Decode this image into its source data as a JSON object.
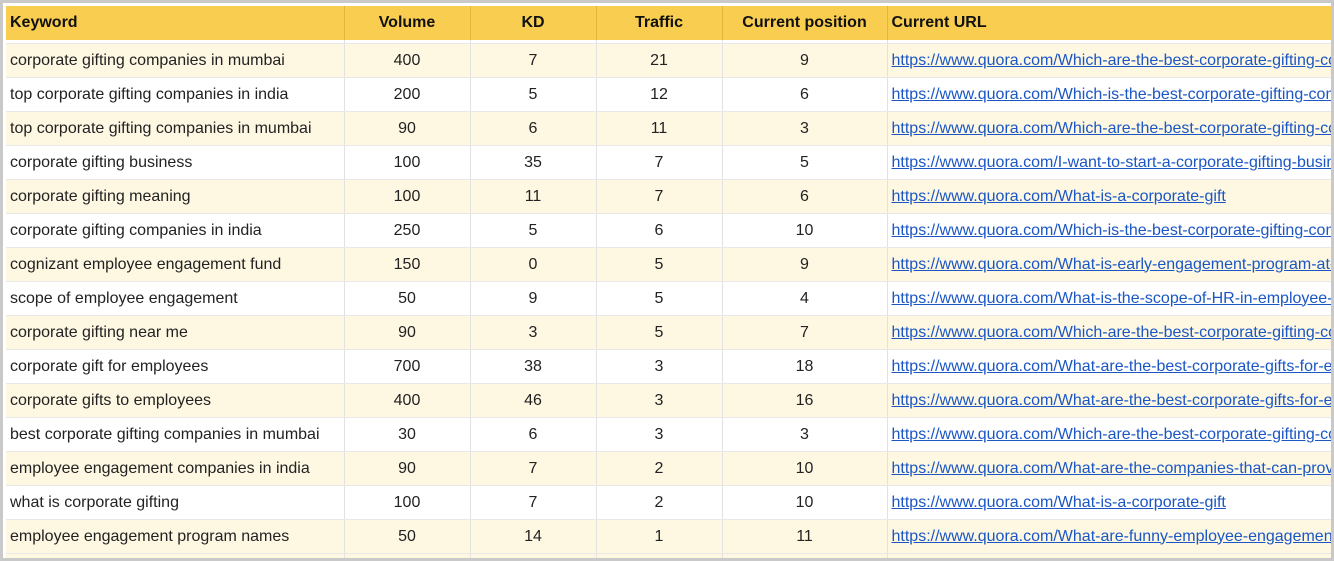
{
  "headers": {
    "keyword": "Keyword",
    "volume": "Volume",
    "kd": "KD",
    "traffic": "Traffic",
    "position": "Current position",
    "url": "Current URL"
  },
  "rows": [
    {
      "keyword": "corporate gifting companies in mumbai",
      "volume": "400",
      "kd": "7",
      "traffic": "21",
      "position": "9",
      "url": "https://www.quora.com/Which-are-the-best-corporate-gifting-companies-in-Mumbai"
    },
    {
      "keyword": "top corporate gifting companies in india",
      "volume": "200",
      "kd": "5",
      "traffic": "12",
      "position": "6",
      "url": "https://www.quora.com/Which-is-the-best-corporate-gifting-company-in-India"
    },
    {
      "keyword": "top corporate gifting companies in mumbai",
      "volume": "90",
      "kd": "6",
      "traffic": "11",
      "position": "3",
      "url": "https://www.quora.com/Which-are-the-best-corporate-gifting-companies-in-Mumbai"
    },
    {
      "keyword": "corporate gifting business",
      "volume": "100",
      "kd": "35",
      "traffic": "7",
      "position": "5",
      "url": "https://www.quora.com/I-want-to-start-a-corporate-gifting-business"
    },
    {
      "keyword": "corporate gifting meaning",
      "volume": "100",
      "kd": "11",
      "traffic": "7",
      "position": "6",
      "url": "https://www.quora.com/What-is-a-corporate-gift"
    },
    {
      "keyword": "corporate gifting companies in india",
      "volume": "250",
      "kd": "5",
      "traffic": "6",
      "position": "10",
      "url": "https://www.quora.com/Which-is-the-best-corporate-gifting-company-in-India"
    },
    {
      "keyword": "cognizant employee engagement fund",
      "volume": "150",
      "kd": "0",
      "traffic": "5",
      "position": "9",
      "url": "https://www.quora.com/What-is-early-engagement-program-at-Cognizant"
    },
    {
      "keyword": "scope of employee engagement",
      "volume": "50",
      "kd": "9",
      "traffic": "5",
      "position": "4",
      "url": "https://www.quora.com/What-is-the-scope-of-HR-in-employee-engagement"
    },
    {
      "keyword": "corporate gifting near me",
      "volume": "90",
      "kd": "3",
      "traffic": "5",
      "position": "7",
      "url": "https://www.quora.com/Which-are-the-best-corporate-gifting-companies-in-Mumbai"
    },
    {
      "keyword": "corporate gift for employees",
      "volume": "700",
      "kd": "38",
      "traffic": "3",
      "position": "18",
      "url": "https://www.quora.com/What-are-the-best-corporate-gifts-for-employees"
    },
    {
      "keyword": "corporate gifts to employees",
      "volume": "400",
      "kd": "46",
      "traffic": "3",
      "position": "16",
      "url": "https://www.quora.com/What-are-the-best-corporate-gifts-for-employees"
    },
    {
      "keyword": "best corporate gifting companies in mumbai",
      "volume": "30",
      "kd": "6",
      "traffic": "3",
      "position": "3",
      "url": "https://www.quora.com/Which-are-the-best-corporate-gifting-companies-in-Mumbai"
    },
    {
      "keyword": "employee engagement companies in india",
      "volume": "90",
      "kd": "7",
      "traffic": "2",
      "position": "10",
      "url": "https://www.quora.com/What-are-the-companies-that-can-provide-employee-engagement"
    },
    {
      "keyword": "what is corporate gifting",
      "volume": "100",
      "kd": "7",
      "traffic": "2",
      "position": "10",
      "url": "https://www.quora.com/What-is-a-corporate-gift"
    },
    {
      "keyword": "employee engagement program names",
      "volume": "50",
      "kd": "14",
      "traffic": "1",
      "position": "11",
      "url": "https://www.quora.com/What-are-funny-employee-engagement-program-names"
    }
  ]
}
